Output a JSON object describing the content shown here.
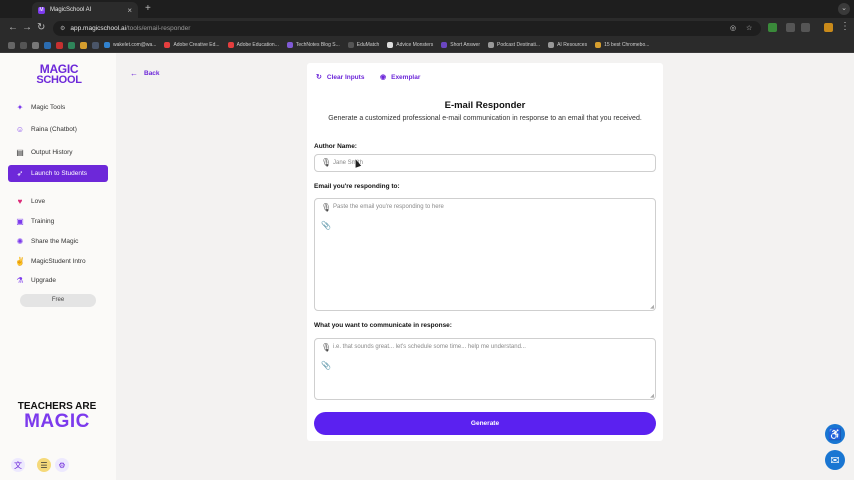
{
  "browser": {
    "tab_title": "MagicSchool AI",
    "tab_favicon": "M",
    "url_domain": "app.magicschool.ai",
    "url_path": "/tools/email-responder",
    "bookmarks": [
      "wakelet.com@wa...",
      "Adobe Creative Ed...",
      "Adobe Education...",
      "TechNotes Blog S...",
      "EduMatch",
      "Advice Monsters",
      "Short Answer",
      "Podcast Destinati...",
      "AI Resources",
      "15 best Chromebo..."
    ]
  },
  "sidebar": {
    "logo_line1": "MAGIC",
    "logo_line2": "SCHOOL",
    "items": [
      {
        "label": "Magic Tools",
        "icon": "magic-tools-icon"
      },
      {
        "label": "Raina (Chatbot)",
        "icon": "chatbot-icon"
      },
      {
        "label": "Output History",
        "icon": "history-icon"
      },
      {
        "label": "Launch to Students",
        "icon": "rocket-icon"
      },
      {
        "label": "Love",
        "icon": "heart-icon"
      },
      {
        "label": "Training",
        "icon": "training-icon"
      },
      {
        "label": "Share the Magic",
        "icon": "share-icon"
      },
      {
        "label": "MagicStudent Intro",
        "icon": "student-icon"
      },
      {
        "label": "Upgrade",
        "icon": "upgrade-icon"
      }
    ],
    "plan_label": "Free",
    "banner_line1": "TEACHERS ARE",
    "banner_line2": "MAGIC"
  },
  "main": {
    "back_label": "Back",
    "clear_inputs_label": "Clear Inputs",
    "exemplar_label": "Exemplar",
    "title": "E-mail Responder",
    "description": "Generate a customized professional e-mail communication in response to an email that you received.",
    "author_label": "Author Name:",
    "author_placeholder": "Jane Smith",
    "email_label": "Email you're responding to:",
    "email_placeholder": "Paste the email you're responding to here",
    "response_label": "What you want to communicate in response:",
    "response_placeholder": "i.e. that sounds great... let's schedule some time... help me understand...",
    "generate_label": "Generate"
  },
  "colors": {
    "brand": "#6d28d9",
    "generate_button": "#5b21f0",
    "accessibility_button": "#1976d2"
  }
}
